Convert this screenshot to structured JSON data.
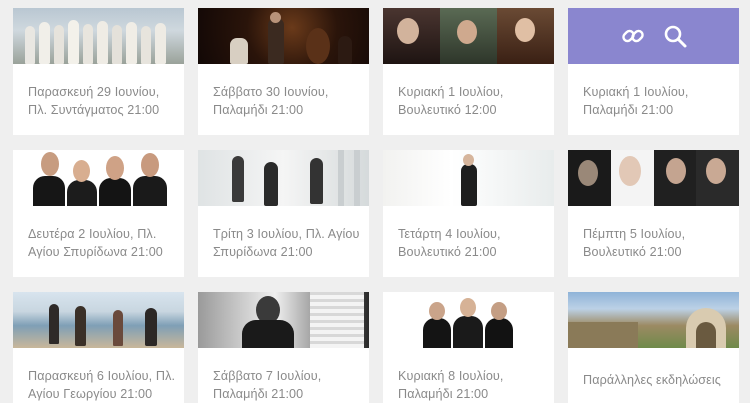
{
  "events": [
    {
      "caption": "Παρασκευή 29 Ιουνίου, Πλ. Συντάγματος 21:00"
    },
    {
      "caption": "Σάββατο 30 Ιουνίου, Παλαμήδι 21:00"
    },
    {
      "caption": "Κυριακή 1 Ιουλίου, Βουλευτικό 12:00"
    },
    {
      "caption": "Κυριακή 1 Ιουλίου, Παλαμήδι 21:00"
    },
    {
      "caption": "Δευτέρα 2 Ιουλίου, Πλ. Αγίου Σπυρίδωνα 21:00"
    },
    {
      "caption": "Τρίτη 3 Ιουλίου, Πλ. Αγίου Σπυρίδωνα 21:00"
    },
    {
      "caption": "Τετάρτη 4 Ιουλίου, Βουλευτικό 21:00"
    },
    {
      "caption": "Πέμπτη 5 Ιουλίου, Βουλευτικό 21:00"
    },
    {
      "caption": "Παρασκευή 6 Ιουλίου, Πλ. Αγίου Γεωργίου 21:00"
    },
    {
      "caption": "Σάββατο 7 Ιουλίου, Παλαμήδι 21:00"
    },
    {
      "caption": "Κυριακή 8 Ιουλίου, Παλαμήδι 21:00"
    },
    {
      "caption": "Παράλληλες εκδηλώσεις"
    }
  ],
  "hover_overlay": {
    "icons": [
      "link-icon",
      "search-icon"
    ],
    "color": "#8a86cf"
  }
}
